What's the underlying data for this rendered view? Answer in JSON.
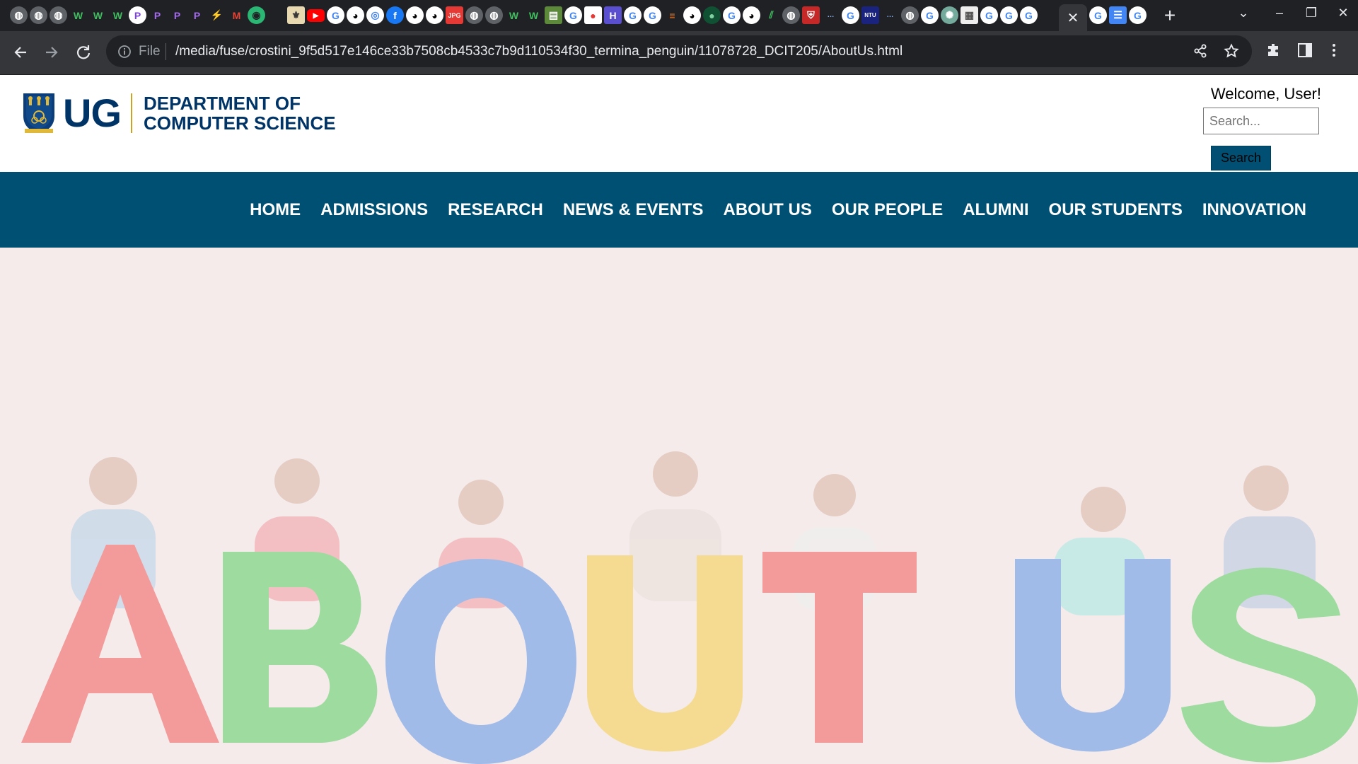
{
  "browser": {
    "active_tab_close": "✕",
    "new_tab": "+",
    "address": {
      "scheme_label": "File",
      "url": "/media/fuse/crostini_9f5d517e146ce33b7508cb4533c7b9d110534f30_termina_penguin/11078728_DCIT205/AboutUs.html"
    }
  },
  "header": {
    "logo_text": "UG",
    "dept_line1": "DEPARTMENT OF",
    "dept_line2": "COMPUTER SCIENCE",
    "welcome": "Welcome, User!",
    "search_placeholder": "Search...",
    "search_button": "Search"
  },
  "nav": {
    "items": [
      "HOME",
      "ADMISSIONS",
      "RESEARCH",
      "NEWS & EVENTS",
      "ABOUT US",
      "OUR PEOPLE",
      "ALUMNI",
      "OUR STUDENTS",
      "INNOVATION"
    ]
  },
  "hero": {
    "image_text": "ABOUT US",
    "colors": {
      "red": "#f28585",
      "green": "#85d68a",
      "blue": "#8aaee8",
      "yellow": "#f5d679"
    }
  }
}
